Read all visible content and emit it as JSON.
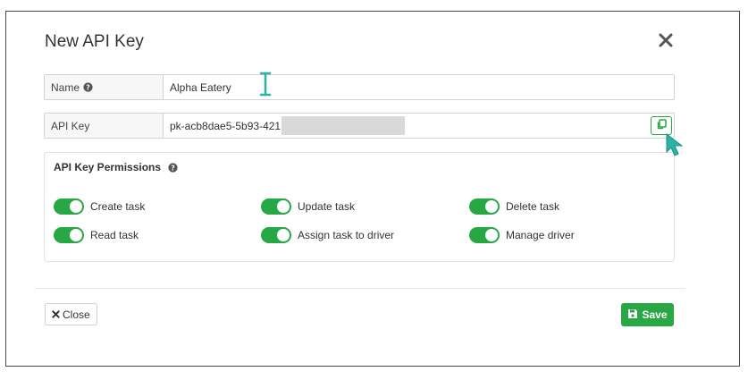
{
  "modal": {
    "title": "New API Key",
    "close_icon": "close-icon"
  },
  "name_field": {
    "label": "Name",
    "help_icon": "question-circle-icon",
    "value": "Alpha Eatery"
  },
  "api_key_field": {
    "label": "API Key",
    "value": "pk-acb8dae5-5b93-421",
    "copy_icon": "copy-icon"
  },
  "permissions": {
    "title": "API Key Permissions",
    "help_icon": "question-circle-icon",
    "items": [
      {
        "label": "Create task",
        "enabled": true
      },
      {
        "label": "Update task",
        "enabled": true
      },
      {
        "label": "Delete task",
        "enabled": true
      },
      {
        "label": "Read task",
        "enabled": true
      },
      {
        "label": "Assign task to driver",
        "enabled": true
      },
      {
        "label": "Manage driver",
        "enabled": true
      }
    ]
  },
  "footer": {
    "close_label": "Close",
    "save_label": "Save"
  },
  "colors": {
    "accent": "#28a745",
    "cursor": "#2bb3a3"
  }
}
